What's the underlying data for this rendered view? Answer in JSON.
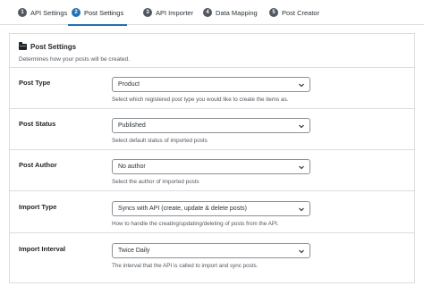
{
  "tabs": [
    {
      "number": "1",
      "label": "API Settings"
    },
    {
      "number": "2",
      "label": "Post Settings"
    },
    {
      "number": "3",
      "label": "API Importer"
    },
    {
      "number": "4",
      "label": "Data Mapping"
    },
    {
      "number": "5",
      "label": "Post Creator"
    }
  ],
  "panel": {
    "title": "Post Settings",
    "description": "Determines how your posts will be created."
  },
  "fields": [
    {
      "label": "Post Type",
      "value": "Product",
      "help": "Select which registered post type you would like to create the items as."
    },
    {
      "label": "Post Status",
      "value": "Published",
      "help": "Select default status of imported posts"
    },
    {
      "label": "Post Author",
      "value": "No author",
      "help": "Select the author of imported posts"
    },
    {
      "label": "Import Type",
      "value": "Syncs with API (create, update & delete posts)",
      "help": "How to handle the creating/updating/deleting of posts from the API."
    },
    {
      "label": "Import Interval",
      "value": "Twice Daily",
      "help": "The interval that the API is called to import and sync posts."
    }
  ],
  "colors": {
    "accent": "#2271b1",
    "inactive_badge": "#50575e",
    "border": "#dcdcde"
  }
}
